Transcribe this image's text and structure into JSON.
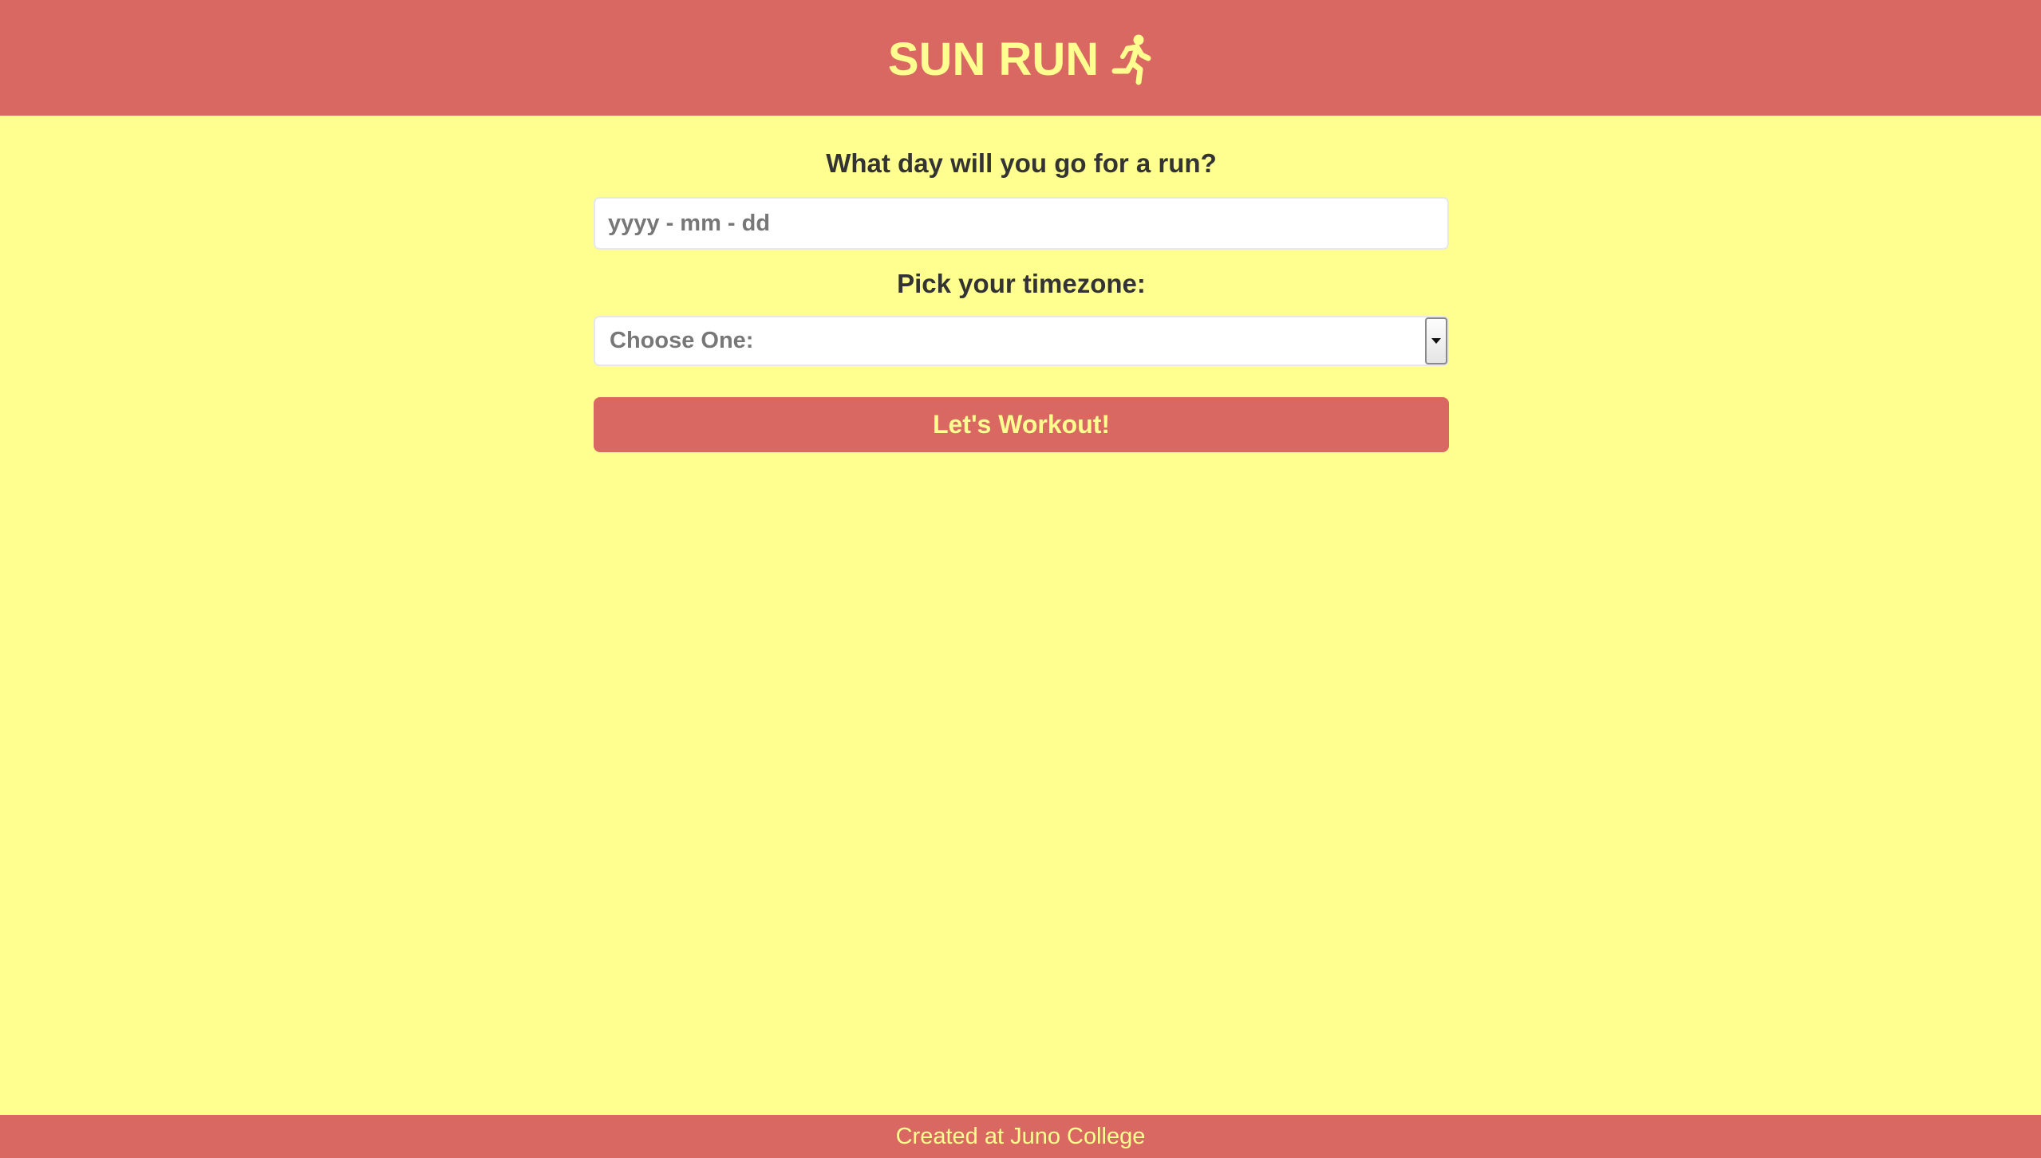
{
  "header": {
    "title": "SUN RUN",
    "icon": "running-person-icon"
  },
  "form": {
    "date_label": "What day will you go for a run?",
    "date_placeholder": "yyyy - mm - dd",
    "date_value": "",
    "timezone_label": "Pick your timezone:",
    "timezone_selected": "Choose One:",
    "submit_label": "Let's Workout!"
  },
  "footer": {
    "text": "Created at Juno College"
  },
  "colors": {
    "background": "#ffff8f",
    "accent": "#d96762",
    "text": "#333333"
  }
}
